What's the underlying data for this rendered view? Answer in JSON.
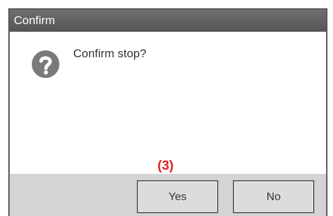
{
  "dialog": {
    "title": "Confirm",
    "message": "Confirm stop?",
    "icon": "question-icon",
    "annotation": "(3)",
    "buttons": {
      "yes_label": "Yes",
      "no_label": "No"
    }
  },
  "colors": {
    "titlebar": "#5e5e5e",
    "footer": "#d4d4d4",
    "button_face": "#dcdcdc",
    "icon": "#7a7a7a",
    "annotation": "#e02020"
  }
}
